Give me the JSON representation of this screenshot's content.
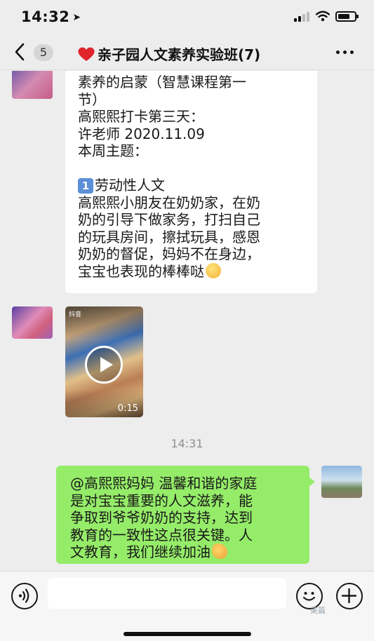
{
  "status": {
    "time": "14:32",
    "battery_level": 0.72
  },
  "nav": {
    "back_count": "5",
    "title": "亲子园人文素养实验班(7)"
  },
  "messages": {
    "first": {
      "lines": [
        "素养的启蒙（智慧课程第一",
        "节）",
        "高熙熙打卡第三天：",
        "许老师 2020.11.09",
        "本周主题：",
        "",
        "劳动性人文",
        "高熙熙小朋友在奶奶家，在奶",
        "奶的引导下做家务，打扫自己",
        "的玩具房间，擦拭玩具，感恩",
        "奶奶的督促，妈妈不在身边，",
        "宝宝也表现的棒棒哒"
      ],
      "number_badge": "1"
    },
    "video": {
      "tag": "抖音",
      "duration": "0:15"
    },
    "timestamp": "14:31",
    "reply": {
      "lines": [
        "@高熙熙妈妈 温馨和谐的家庭",
        "是对宝宝重要的人文滋养，能",
        "争取到爷爷奶奶的支持，达到",
        "教育的一致性这点很关键。人",
        "文教育，我们继续加油"
      ]
    }
  },
  "input": {
    "placeholder": ""
  },
  "watermark": "美篇",
  "colors": {
    "background": "#ededed",
    "self_bubble": "#95ec69",
    "other_bubble": "#ffffff",
    "heart": "#e0242b"
  },
  "icons": [
    "signal-icon",
    "wifi-icon",
    "battery-icon",
    "back-chevron-icon",
    "heart-icon",
    "more-icon",
    "play-icon",
    "voice-icon",
    "emoji-icon",
    "plus-icon"
  ]
}
